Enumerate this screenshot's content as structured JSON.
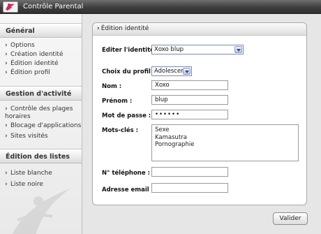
{
  "window": {
    "title": "Contrôle Parental"
  },
  "sidebar": {
    "sections": [
      {
        "header": "Général",
        "items": [
          "Options",
          "Création identité",
          "Édition identité",
          "Édition profil"
        ]
      },
      {
        "header": "Gestion d'activité",
        "items": [
          "Contrôle des plages horaires",
          "Blocage d'applications",
          "Sites visités"
        ]
      },
      {
        "header": "Édition des listes",
        "items": [
          "Liste blanche",
          "Liste noire"
        ]
      }
    ]
  },
  "panel": {
    "title": "Édition identité",
    "identity_label": "Editer l'identité :",
    "identity_value": "Xoxo blup",
    "profile_label": "Choix du profil :",
    "profile_value": "Adolescent",
    "nom_label": "Nom :",
    "nom_value": "Xoxo",
    "prenom_label": "Prénom :",
    "prenom_value": "blup",
    "password_label": "Mot de passe :",
    "password_value": "••••••",
    "keywords_label": "Mots-clés :",
    "keywords": [
      "Sexe",
      "Kamasutra",
      "Pornographie"
    ],
    "phone_label": "N° téléphone :",
    "phone_value": "",
    "email_label": "Adresse email :",
    "email_value": ""
  },
  "actions": {
    "submit_label": "Valider"
  },
  "colors": {
    "titlebar": "#3f3f3f",
    "accent_logo": "#d0285f",
    "select_border": "#7a8bb0"
  }
}
